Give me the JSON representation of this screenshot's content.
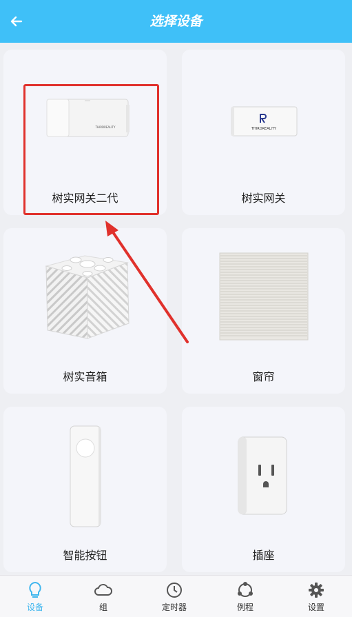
{
  "header": {
    "title": "选择设备"
  },
  "devices": [
    {
      "label": "树实网关二代",
      "icon": "gateway-gen2-image"
    },
    {
      "label": "树实网关",
      "icon": "gateway-image"
    },
    {
      "label": "树实音箱",
      "icon": "speaker-image"
    },
    {
      "label": "窗帘",
      "icon": "curtain-image"
    },
    {
      "label": "智能按钮",
      "icon": "smart-button-image"
    },
    {
      "label": "插座",
      "icon": "plug-image"
    }
  ],
  "gateway_brand_text": "THIRDREALITY",
  "tabs": [
    {
      "label": "设备",
      "icon": "bulb-icon",
      "active": true
    },
    {
      "label": "组",
      "icon": "cloud-icon"
    },
    {
      "label": "定时器",
      "icon": "clock-icon"
    },
    {
      "label": "例程",
      "icon": "routine-icon"
    },
    {
      "label": "设置",
      "icon": "gear-icon"
    }
  ],
  "colors": {
    "header": "#3fc0f8",
    "active_tab": "#3fb6ee",
    "highlight": "#e0312c"
  }
}
